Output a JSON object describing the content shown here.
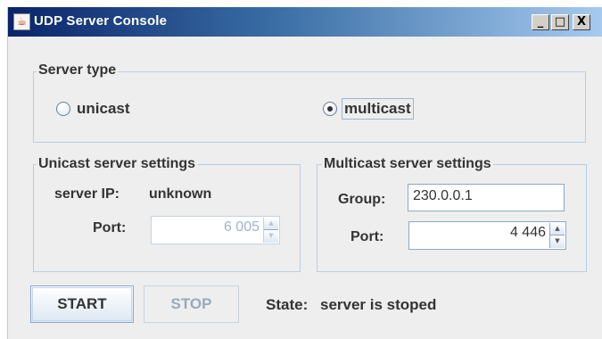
{
  "window": {
    "title": "UDP Server Console",
    "icon": "java-cup-icon",
    "controls": {
      "minimize": "_",
      "maximize": "□",
      "close": "X"
    }
  },
  "server_type": {
    "title": "Server type",
    "options": [
      {
        "label": "unicast",
        "selected": false
      },
      {
        "label": "multicast",
        "selected": true
      }
    ]
  },
  "unicast": {
    "title": "Unicast server settings",
    "server_ip_label": "server IP:",
    "server_ip_value": "unknown",
    "port_label": "Port:",
    "port_value": "6 005",
    "enabled": false
  },
  "multicast": {
    "title": "Multicast server settings",
    "group_label": "Group:",
    "group_value": "230.0.0.1",
    "port_label": "Port:",
    "port_value": "4 446",
    "enabled": true
  },
  "actions": {
    "start_label": "START",
    "stop_label": "STOP",
    "state_label": "State:",
    "state_value": "server is stoped"
  },
  "colors": {
    "window_bg": "#eeeeee",
    "title_gradient_start": "#0a246a",
    "title_gradient_end": "#a6caf0",
    "border": "#b8cfe5",
    "text": "#333333",
    "disabled_text": "#9fb4cf"
  }
}
